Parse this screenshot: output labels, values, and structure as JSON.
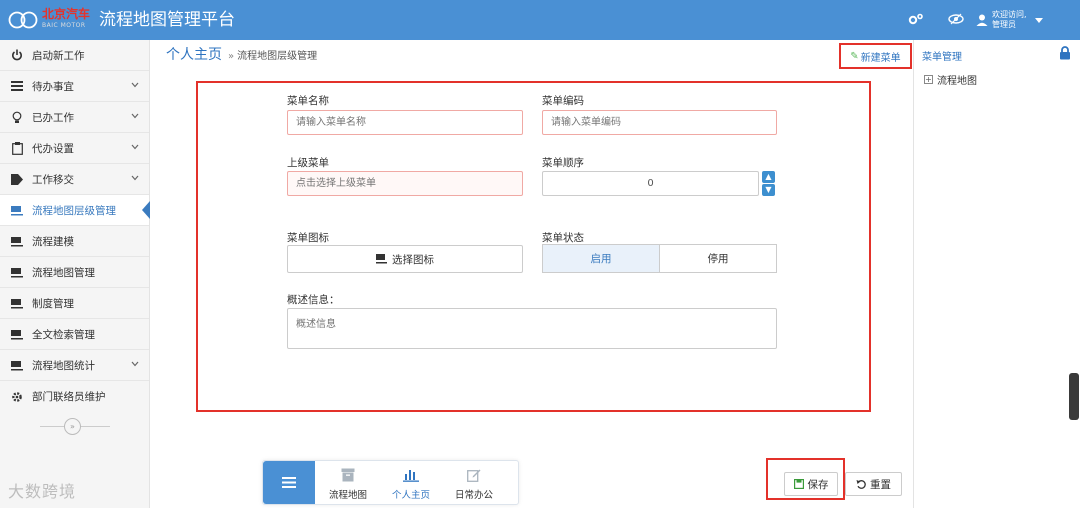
{
  "header": {
    "brand_name": "北京汽车",
    "brand_sub": "BAIC MOTOR",
    "app_title": "流程地图管理平台",
    "user_greeting": "欢迎访问,",
    "user_name": "管理员"
  },
  "sidebar": {
    "items": [
      {
        "label": "启动新工作",
        "icon": "power-icon",
        "has_chevron": false
      },
      {
        "label": "待办事宜",
        "icon": "list-icon",
        "has_chevron": true
      },
      {
        "label": "已办工作",
        "icon": "lightbulb-icon",
        "has_chevron": true
      },
      {
        "label": "代办设置",
        "icon": "clipboard-icon",
        "has_chevron": true
      },
      {
        "label": "工作移交",
        "icon": "tag-icon",
        "has_chevron": true
      },
      {
        "label": "流程地图层级管理",
        "icon": "cup-icon",
        "has_chevron": false,
        "active": true
      },
      {
        "label": "流程建模",
        "icon": "cup-icon",
        "has_chevron": false
      },
      {
        "label": "流程地图管理",
        "icon": "cup-icon",
        "has_chevron": false
      },
      {
        "label": "制度管理",
        "icon": "cup-icon",
        "has_chevron": false
      },
      {
        "label": "全文检索管理",
        "icon": "cup-icon",
        "has_chevron": false
      },
      {
        "label": "流程地图统计",
        "icon": "cup-icon",
        "has_chevron": true
      },
      {
        "label": "部门联络员维护",
        "icon": "gear-icon",
        "has_chevron": false
      }
    ],
    "collapse_glyph": "»",
    "watermark": "大数跨境"
  },
  "breadcrumb": {
    "home": "个人主页",
    "separator": "»",
    "current": "流程地图层级管理"
  },
  "actions": {
    "new_menu": "新建菜单"
  },
  "form": {
    "menu_name": {
      "label": "菜单名称",
      "placeholder": "请输入菜单名称"
    },
    "menu_code": {
      "label": "菜单编码",
      "placeholder": "请输入菜单编码"
    },
    "parent_menu": {
      "label": "上级菜单",
      "placeholder": "点击选择上级菜单"
    },
    "menu_order": {
      "label": "菜单顺序",
      "value": "0"
    },
    "menu_icon": {
      "label": "菜单图标",
      "button": "选择图标"
    },
    "menu_status": {
      "label": "菜单状态",
      "options": [
        "启用",
        "停用"
      ],
      "selected": "启用"
    },
    "description": {
      "label": "概述信息：",
      "placeholder": "概述信息"
    }
  },
  "right_panel": {
    "title": "菜单管理",
    "tree_root": "流程地图",
    "tree_toggle": "+"
  },
  "bottom_nav": {
    "items": [
      {
        "label": "流程地图",
        "icon": "archive-icon"
      },
      {
        "label": "个人主页",
        "icon": "bar-chart-icon",
        "active": true
      },
      {
        "label": "日常办公",
        "icon": "edit-icon"
      }
    ]
  },
  "footer_buttons": {
    "save": "保存",
    "reset": "重置"
  },
  "colors": {
    "topbar": "#4a90d4",
    "accent": "#2f74c0",
    "highlight_border": "#e3312a",
    "input_border": "#f0a9a4"
  }
}
